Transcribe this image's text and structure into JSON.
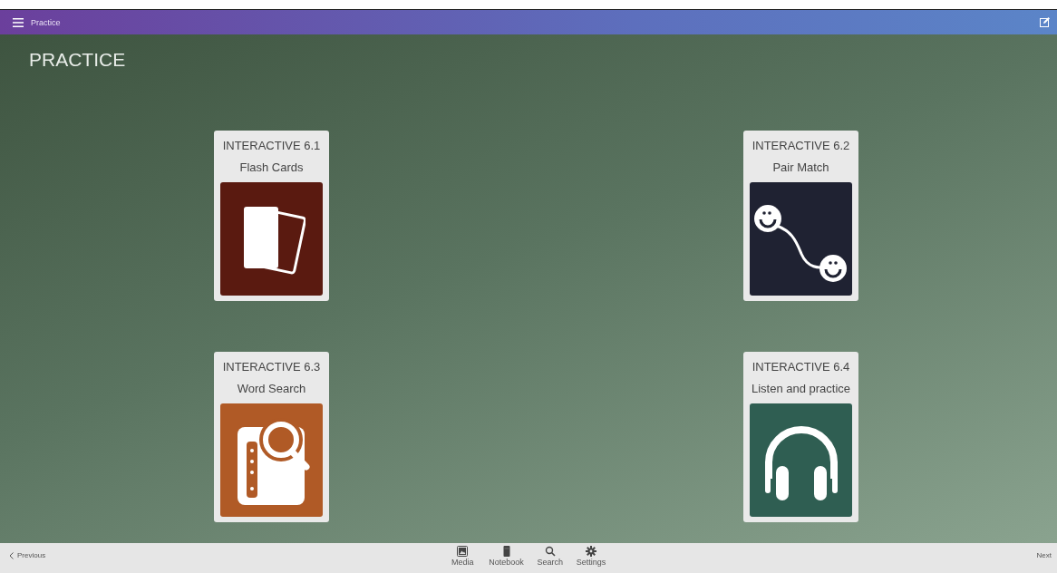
{
  "top_bar": {
    "title": "Practice"
  },
  "page": {
    "heading": "PRACTICE"
  },
  "activities": [
    {
      "title": "INTERACTIVE 6.1",
      "subtitle": "Flash Cards",
      "kind": "cards",
      "color": "#5a1a10"
    },
    {
      "title": "INTERACTIVE 6.2",
      "subtitle": "Pair Match",
      "kind": "pair",
      "color": "#1f2232"
    },
    {
      "title": "INTERACTIVE 6.3",
      "subtitle": "Word Search",
      "kind": "wordsearch",
      "color": "#b05a26"
    },
    {
      "title": "INTERACTIVE 6.4",
      "subtitle": "Listen and practice",
      "kind": "headphones",
      "color": "#2f5e52"
    }
  ],
  "bottom_bar": {
    "previous": "Previous",
    "next": "Next",
    "tools": [
      {
        "label": "Media",
        "kind": "media"
      },
      {
        "label": "Notebook",
        "kind": "notebook"
      },
      {
        "label": "Search",
        "kind": "search"
      },
      {
        "label": "Settings",
        "kind": "settings"
      }
    ]
  }
}
